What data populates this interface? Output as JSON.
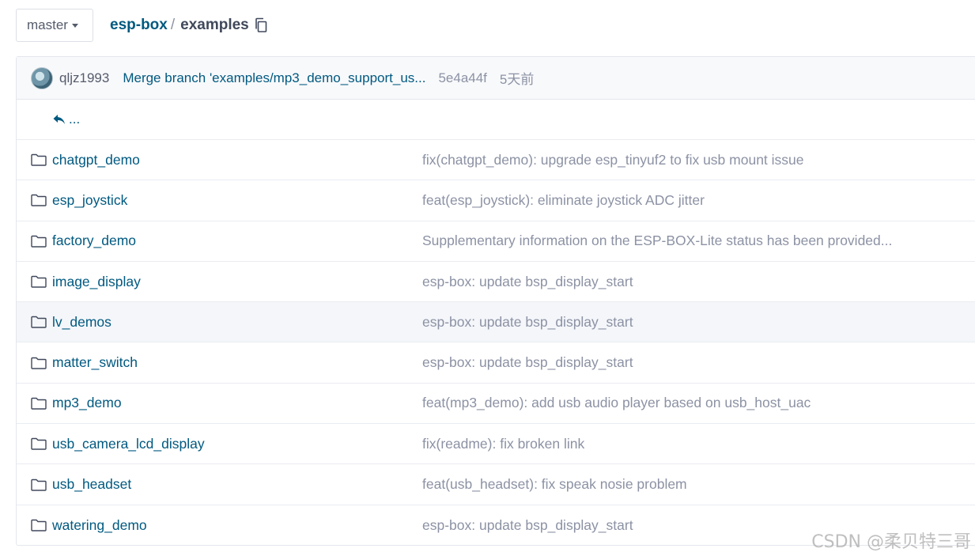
{
  "branch": {
    "label": "master"
  },
  "breadcrumb": {
    "repo": "esp-box",
    "separator": "/",
    "dir": "examples"
  },
  "commit": {
    "author": "qljz1993",
    "message": "Merge branch 'examples/mp3_demo_support_us...",
    "sha": "5e4a44f",
    "time": "5天前"
  },
  "parent": {
    "label": "..."
  },
  "rows": [
    {
      "name": "chatgpt_demo",
      "message": "fix(chatgpt_demo): upgrade esp_tinyuf2 to fix usb mount issue"
    },
    {
      "name": "esp_joystick",
      "message": "feat(esp_joystick): eliminate joystick ADC jitter"
    },
    {
      "name": "factory_demo",
      "message": "Supplementary information on the ESP-BOX-Lite status has been provided..."
    },
    {
      "name": "image_display",
      "message": "esp-box: update bsp_display_start"
    },
    {
      "name": "lv_demos",
      "message": "esp-box: update bsp_display_start"
    },
    {
      "name": "matter_switch",
      "message": "esp-box: update bsp_display_start"
    },
    {
      "name": "mp3_demo",
      "message": "feat(mp3_demo): add usb audio player based on usb_host_uac"
    },
    {
      "name": "usb_camera_lcd_display",
      "message": "fix(readme): fix broken link"
    },
    {
      "name": "usb_headset",
      "message": "feat(usb_headset): fix speak nosie problem"
    },
    {
      "name": "watering_demo",
      "message": "esp-box: update bsp_display_start"
    }
  ],
  "watermark": "CSDN @柔贝特三哥"
}
